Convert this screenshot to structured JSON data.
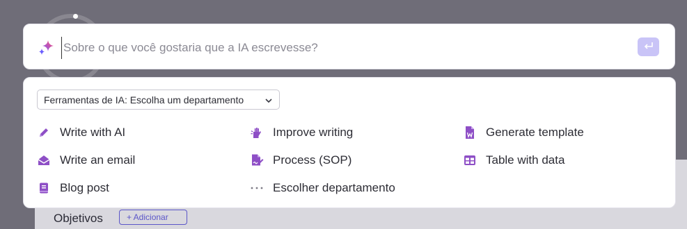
{
  "colors": {
    "accent": "#8e4fc6",
    "send_button": "#c9c4f7",
    "overlay": "#6f6d78"
  },
  "background": {
    "section_title": "Objetivos",
    "add_button": "+ Adicionar"
  },
  "prompt": {
    "placeholder": "Sobre o que você gostaria que a IA escrevesse?",
    "value": ""
  },
  "panel": {
    "department_select": "Ferramentas de IA: Escolha um departamento",
    "tools": [
      {
        "label": "Write with AI",
        "icon": "pencil-icon"
      },
      {
        "label": "Write an email",
        "icon": "envelope-open-icon"
      },
      {
        "label": "Blog post",
        "icon": "book-icon"
      },
      {
        "label": "Improve writing",
        "icon": "hand-sparkle-icon"
      },
      {
        "label": "Process (SOP)",
        "icon": "file-signature-icon"
      },
      {
        "label": "Escolher departamento",
        "icon": "ellipsis-icon"
      },
      {
        "label": "Generate template",
        "icon": "word-file-icon"
      },
      {
        "label": "Table with data",
        "icon": "table-icon"
      }
    ]
  }
}
